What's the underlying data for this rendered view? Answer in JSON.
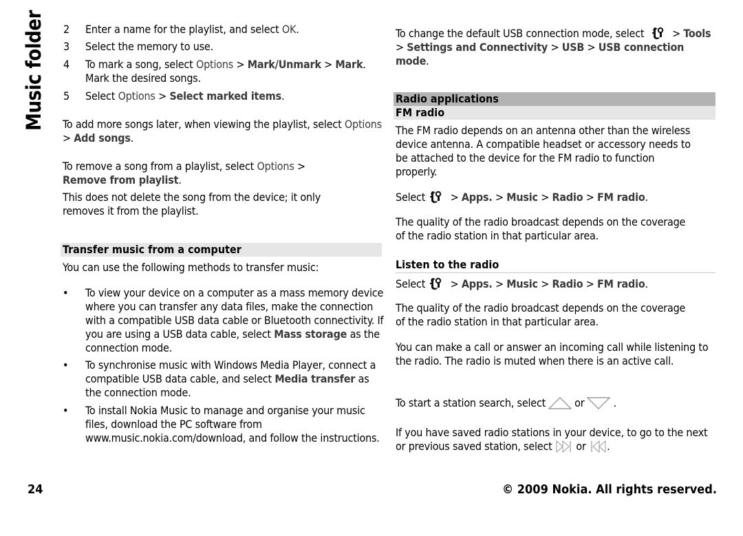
{
  "section_title": "Music folder",
  "left": {
    "steps": [
      {
        "num": "2",
        "pre": "Enter a name for the playlist, and select ",
        "em": "OK",
        "post": "."
      },
      {
        "num": "3",
        "text": "Select the memory to use."
      },
      {
        "num": "4",
        "pre": "To mark a song, select ",
        "m1": "Options",
        "sep1": " > ",
        "m2": "Mark/Unmark",
        "sep2": " > ",
        "m3": "Mark",
        "post": ". Mark the desired songs."
      },
      {
        "num": "5",
        "pre": "Select ",
        "m1": "Options",
        "sep1": " > ",
        "m2": "Select marked items",
        "post": "."
      }
    ],
    "add_songs": {
      "pre": "To add more songs later, when viewing the playlist, select ",
      "m1": "Options",
      "sep": " > ",
      "m2": "Add songs",
      "post": "."
    },
    "remove_song": {
      "pre": "To remove a song from a playlist, select ",
      "m1": "Options",
      "sep": " > ",
      "m2": "Remove from playlist",
      "post": "."
    },
    "remove_note": "This does not delete the song from the device; it only removes it from the playlist.",
    "transfer_heading": "Transfer music from a computer",
    "transfer_intro": "You can use the following methods to transfer music:",
    "bullets": [
      {
        "pre": "To view your device on a computer as a mass memory device where you can transfer any data files, make the connection with a compatible USB data cable or Bluetooth connectivity. If you are using a USB data cable, select ",
        "em": "Mass storage",
        "post": " as the connection mode."
      },
      {
        "pre": "To synchronise music with Windows Media Player, connect a compatible USB data cable, and select ",
        "em": "Media transfer",
        "post": " as the connection mode."
      },
      {
        "text": "To install Nokia Music to manage and organise your music files, download the PC software from www.music.nokia.com/download, and follow the instructions."
      }
    ],
    "bullet_glyph": "•"
  },
  "right": {
    "usb_mode": {
      "pre": "To change the default USB connection mode, select ",
      "icon": "nokia-menu-icon",
      "sep0": " > ",
      "m1": "Tools",
      "sep1": " > ",
      "m2": "Settings and Connectivity",
      "sep2": " > ",
      "m3": "USB",
      "sep3": " > ",
      "m4": "USB connection mode",
      "post": "."
    },
    "radio_heading": "Radio applications",
    "fm_heading": "FM radio",
    "fm_intro": "The FM radio depends on an antenna other than the wireless device antenna. A compatible headset or accessory needs to be attached to the device for the FM radio to function properly.",
    "select_path": {
      "pre": "Select",
      "icon": "nokia-menu-icon",
      "m1": "Apps.",
      "m2": "Music",
      "m3": "Radio",
      "m4": "FM radio",
      "sep": " > ",
      "post": "."
    },
    "quality_note": "The quality of the radio broadcast depends on the coverage of the radio station in that particular area.",
    "listen_heading": "Listen to the radio",
    "call_note": "You can make a call or answer an incoming call while listening to the radio. The radio is muted when there is an active call.",
    "search": {
      "pre": "To start a station search, select",
      "or": "or",
      "post": ".",
      "icon_up": "search-up-icon",
      "icon_down": "search-down-icon"
    },
    "saved": {
      "pre": "If you have saved radio stations in your device, to go to the next or previous saved station, select",
      "or": "or",
      "post": ".",
      "icon_next": "next-station-icon",
      "icon_prev": "previous-station-icon"
    }
  },
  "footer": {
    "page_number": "24",
    "copyright": "© 2009 Nokia. All rights reserved."
  },
  "colors": {
    "highlight_text": "#3a3a3a",
    "band_light": "#e6e6e6",
    "band_dark": "#b3b3b3",
    "rule": "#c8c8c8"
  }
}
